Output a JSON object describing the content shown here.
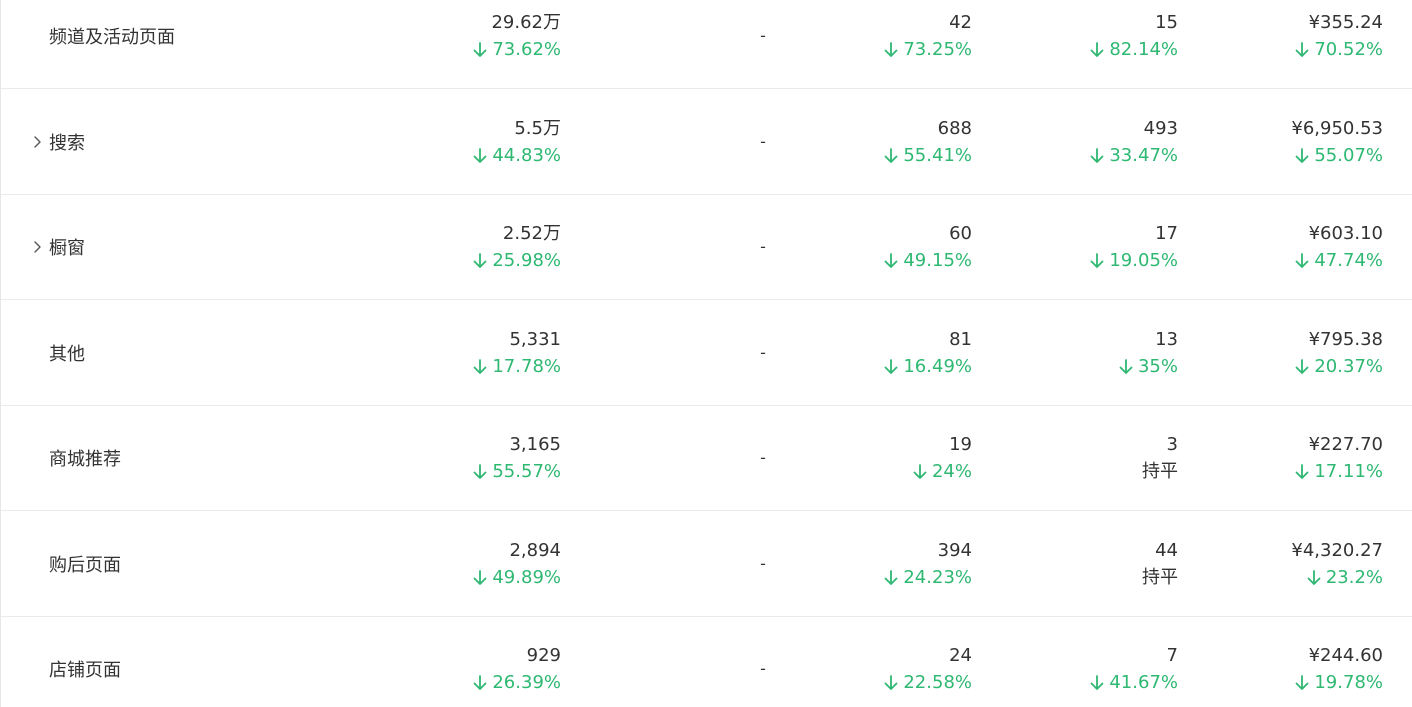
{
  "colors": {
    "down": "#2eb872",
    "text": "#333333",
    "divider": "#ebebeb"
  },
  "icons": {
    "expand": "chevron-right-icon",
    "decrease": "arrow-down-icon"
  },
  "rows": [
    {
      "name": "频道及活动页面",
      "expandable": false,
      "col1": {
        "value": "29.62万",
        "change": "73.62%",
        "dir": "down"
      },
      "col2": {
        "value": "-"
      },
      "col3": {
        "value": "42",
        "change": "73.25%",
        "dir": "down"
      },
      "col4": {
        "value": "15",
        "change": "82.14%",
        "dir": "down"
      },
      "col5": {
        "value": "¥355.24",
        "change": "70.52%",
        "dir": "down"
      }
    },
    {
      "name": "搜索",
      "expandable": true,
      "col1": {
        "value": "5.5万",
        "change": "44.83%",
        "dir": "down"
      },
      "col2": {
        "value": "-"
      },
      "col3": {
        "value": "688",
        "change": "55.41%",
        "dir": "down"
      },
      "col4": {
        "value": "493",
        "change": "33.47%",
        "dir": "down"
      },
      "col5": {
        "value": "¥6,950.53",
        "change": "55.07%",
        "dir": "down"
      }
    },
    {
      "name": "橱窗",
      "expandable": true,
      "col1": {
        "value": "2.52万",
        "change": "25.98%",
        "dir": "down"
      },
      "col2": {
        "value": "-"
      },
      "col3": {
        "value": "60",
        "change": "49.15%",
        "dir": "down"
      },
      "col4": {
        "value": "17",
        "change": "19.05%",
        "dir": "down"
      },
      "col5": {
        "value": "¥603.10",
        "change": "47.74%",
        "dir": "down"
      }
    },
    {
      "name": "其他",
      "expandable": false,
      "col1": {
        "value": "5,331",
        "change": "17.78%",
        "dir": "down"
      },
      "col2": {
        "value": "-"
      },
      "col3": {
        "value": "81",
        "change": "16.49%",
        "dir": "down"
      },
      "col4": {
        "value": "13",
        "change": "35%",
        "dir": "down"
      },
      "col5": {
        "value": "¥795.38",
        "change": "20.37%",
        "dir": "down"
      }
    },
    {
      "name": "商城推荐",
      "expandable": false,
      "col1": {
        "value": "3,165",
        "change": "55.57%",
        "dir": "down"
      },
      "col2": {
        "value": "-"
      },
      "col3": {
        "value": "19",
        "change": "24%",
        "dir": "down"
      },
      "col4": {
        "value": "3",
        "change": "持平",
        "dir": "flat"
      },
      "col5": {
        "value": "¥227.70",
        "change": "17.11%",
        "dir": "down"
      }
    },
    {
      "name": "购后页面",
      "expandable": false,
      "col1": {
        "value": "2,894",
        "change": "49.89%",
        "dir": "down"
      },
      "col2": {
        "value": "-"
      },
      "col3": {
        "value": "394",
        "change": "24.23%",
        "dir": "down"
      },
      "col4": {
        "value": "44",
        "change": "持平",
        "dir": "flat"
      },
      "col5": {
        "value": "¥4,320.27",
        "change": "23.2%",
        "dir": "down"
      }
    },
    {
      "name": "店铺页面",
      "expandable": false,
      "col1": {
        "value": "929",
        "change": "26.39%",
        "dir": "down"
      },
      "col2": {
        "value": "-"
      },
      "col3": {
        "value": "24",
        "change": "22.58%",
        "dir": "down"
      },
      "col4": {
        "value": "7",
        "change": "41.67%",
        "dir": "down"
      },
      "col5": {
        "value": "¥244.60",
        "change": "19.78%",
        "dir": "down"
      }
    }
  ]
}
